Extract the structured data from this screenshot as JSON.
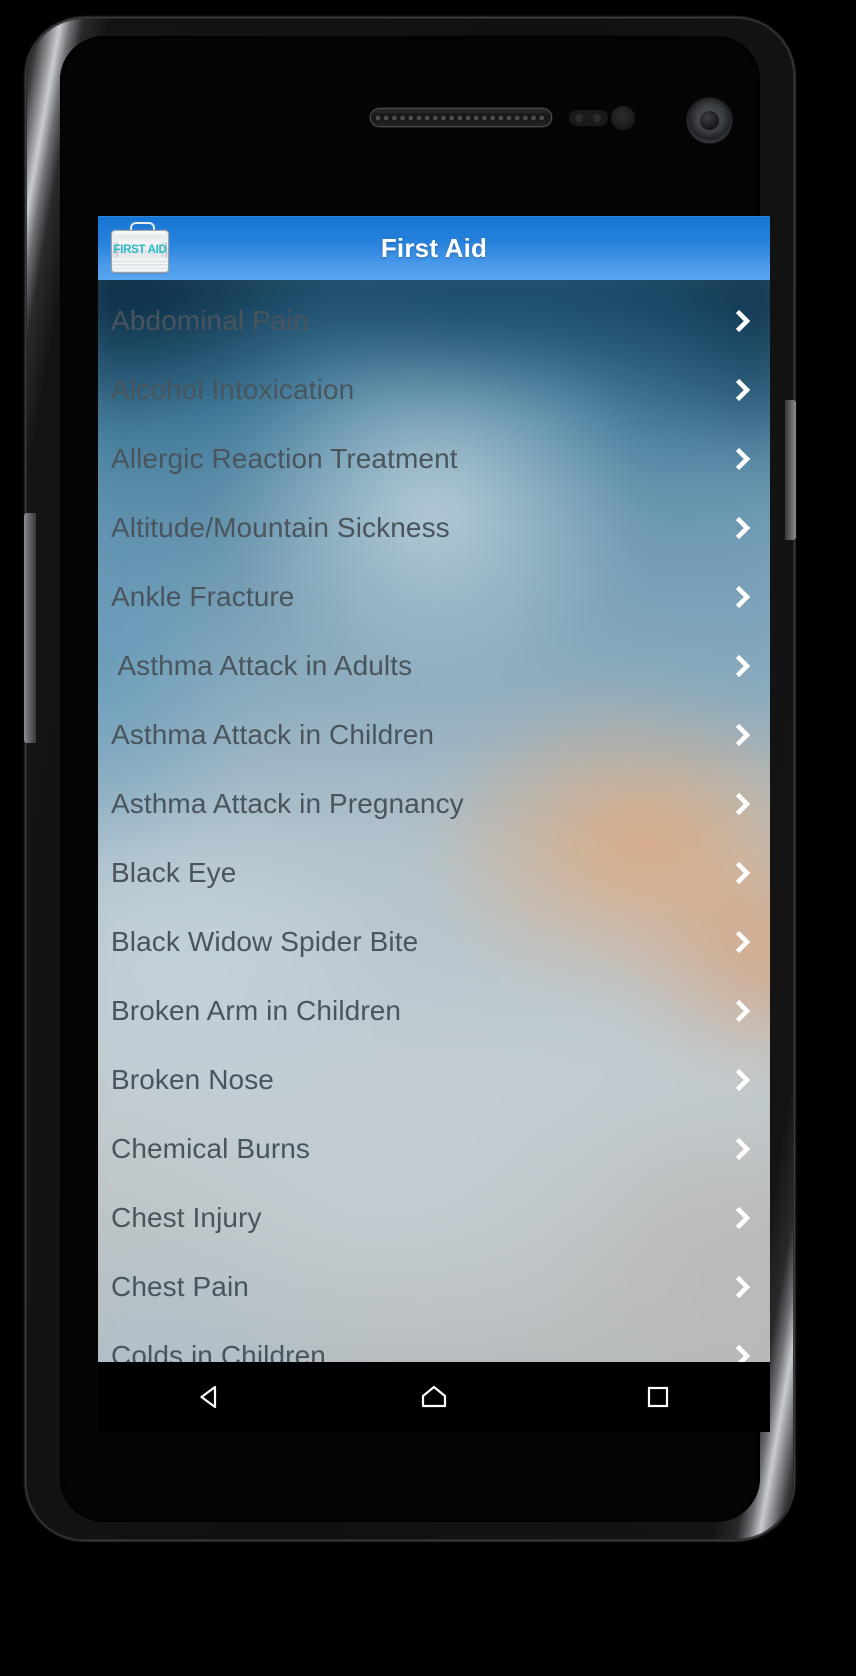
{
  "device": {
    "type": "android-phone",
    "hardware": {
      "earpiece": "earpiece-speaker",
      "proximity_sensor": "proximity-sensor",
      "front_camera": "front-camera",
      "volume_button": "volume-rocker",
      "power_button": "power-button"
    }
  },
  "app": {
    "title": "First Aid",
    "icon_label": "FIRST AID",
    "colors": {
      "action_bar_top": "#1675d1",
      "action_bar_bottom": "#5aa5ef",
      "title_text": "#ffffff",
      "icon_text": "#2cb8c6",
      "list_text": "#4a545c",
      "chevron": "#ffffff"
    }
  },
  "list": {
    "items": [
      {
        "label": "Abdominal Pain"
      },
      {
        "label": "Alcohol Intoxication"
      },
      {
        "label": "Allergic Reaction Treatment"
      },
      {
        "label": "Altitude/Mountain Sickness"
      },
      {
        "label": "Ankle Fracture"
      },
      {
        "label": " Asthma Attack in Adults"
      },
      {
        "label": "Asthma Attack in Children"
      },
      {
        "label": "Asthma Attack in Pregnancy"
      },
      {
        "label": "Black Eye"
      },
      {
        "label": "Black Widow Spider Bite"
      },
      {
        "label": "Broken Arm in Children"
      },
      {
        "label": "Broken Nose"
      },
      {
        "label": "Chemical Burns"
      },
      {
        "label": "Chest Injury"
      },
      {
        "label": "Chest Pain"
      },
      {
        "label": "Colds in Children"
      }
    ]
  },
  "nav_bar": {
    "back_label": "Back",
    "home_label": "Home",
    "recents_label": "Recent apps"
  }
}
